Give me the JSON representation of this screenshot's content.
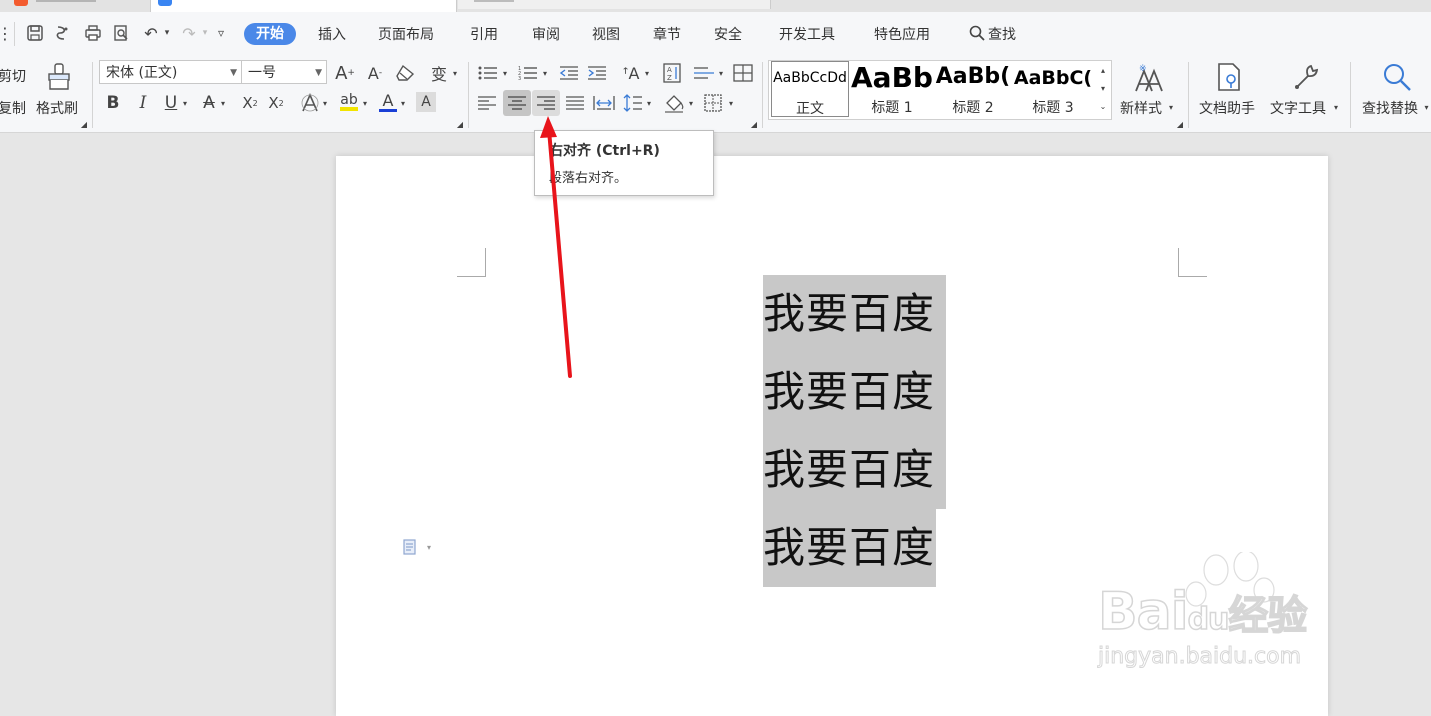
{
  "menu": {
    "items": [
      "开始",
      "插入",
      "页面布局",
      "引用",
      "审阅",
      "视图",
      "章节",
      "安全",
      "开发工具",
      "特色应用"
    ],
    "active": "开始",
    "search_label": "查找"
  },
  "clipboard": {
    "cut_label": "剪切",
    "copy_label": "复制",
    "format_painter_label": "格式刷"
  },
  "font": {
    "family": "宋体 (正文)",
    "size": "一号"
  },
  "styles": [
    {
      "preview": "AaBbCcDd",
      "label": "正文"
    },
    {
      "preview": "AaBb",
      "label": "标题 1"
    },
    {
      "preview": "AaBb(",
      "label": "标题 2"
    },
    {
      "preview": "AaBbC(",
      "label": "标题 3"
    }
  ],
  "tools": {
    "new_style_label": "新样式",
    "doc_assistant_label": "文档助手",
    "text_tools_label": "文字工具",
    "find_replace_label": "查找替换"
  },
  "tooltip": {
    "title": "右对齐 (Ctrl+R)",
    "desc": "段落右对齐。"
  },
  "document": {
    "lines": [
      "我要百度",
      "我要百度",
      "我要百度",
      "我要百度"
    ]
  },
  "watermark": {
    "brand": "Bai",
    "brand_du": "du",
    "brand_cn": "经验",
    "url": "jingyan.baidu.com"
  },
  "colors": {
    "accent": "#4a88e8",
    "arrow": "#e8141b",
    "highlight": "#c8c8c8"
  }
}
